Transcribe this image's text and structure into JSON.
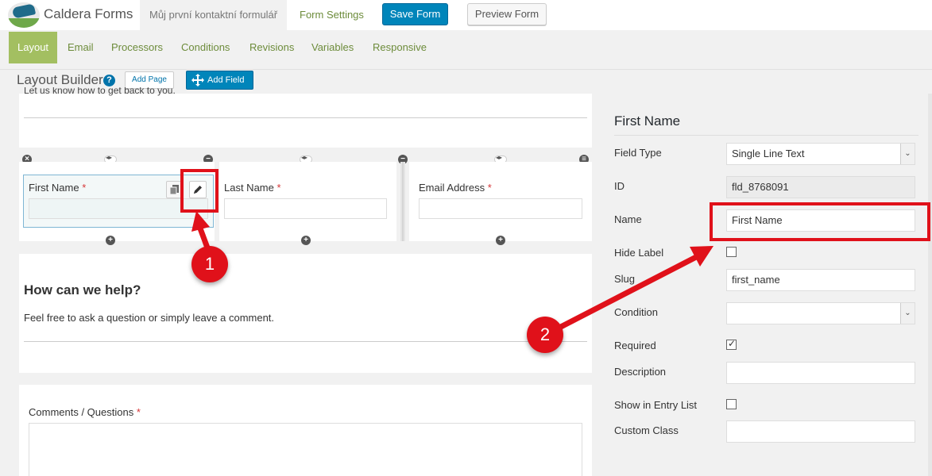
{
  "header": {
    "brand": "Caldera Forms",
    "form_name": "Můj první kontaktní formulář",
    "form_settings": "Form Settings",
    "save_label": "Save Form",
    "preview_label": "Preview Form"
  },
  "tabs": [
    {
      "label": "Layout",
      "active": true
    },
    {
      "label": "Email"
    },
    {
      "label": "Processors"
    },
    {
      "label": "Conditions"
    },
    {
      "label": "Revisions"
    },
    {
      "label": "Variables"
    },
    {
      "label": "Responsive"
    }
  ],
  "builder": {
    "title": "Layout Builder",
    "help": "?",
    "add_page": "Add Page",
    "add_field": "Add Field",
    "intro_text": "Let us know how to get back to you.",
    "fields_row": {
      "first_name": "First Name",
      "last_name": "Last Name",
      "email": "Email Address",
      "required_mark": "*"
    },
    "help_heading": "How can we help?",
    "help_text": "Feel free to ask a question or simply leave a comment.",
    "comments_label": "Comments / Questions"
  },
  "settings": {
    "title": "First Name",
    "field_type_label": "Field Type",
    "field_type_value": "Single Line Text",
    "id_label": "ID",
    "id_value": "fld_8768091",
    "name_label": "Name",
    "name_value": "First Name",
    "hide_label_label": "Hide Label",
    "hide_label_checked": false,
    "slug_label": "Slug",
    "slug_value": "first_name",
    "condition_label": "Condition",
    "condition_value": "",
    "required_label": "Required",
    "required_checked": true,
    "description_label": "Description",
    "description_value": "",
    "entry_list_label": "Show in Entry List",
    "entry_list_checked": false,
    "custom_class_label": "Custom Class",
    "custom_class_value": ""
  },
  "annotations": {
    "badge1": "1",
    "badge2": "2",
    "color": "#e0111a"
  },
  "colors": {
    "accent_green": "#a3bf61",
    "link_green": "#6d8c3b",
    "primary_blue": "#0085ba"
  }
}
